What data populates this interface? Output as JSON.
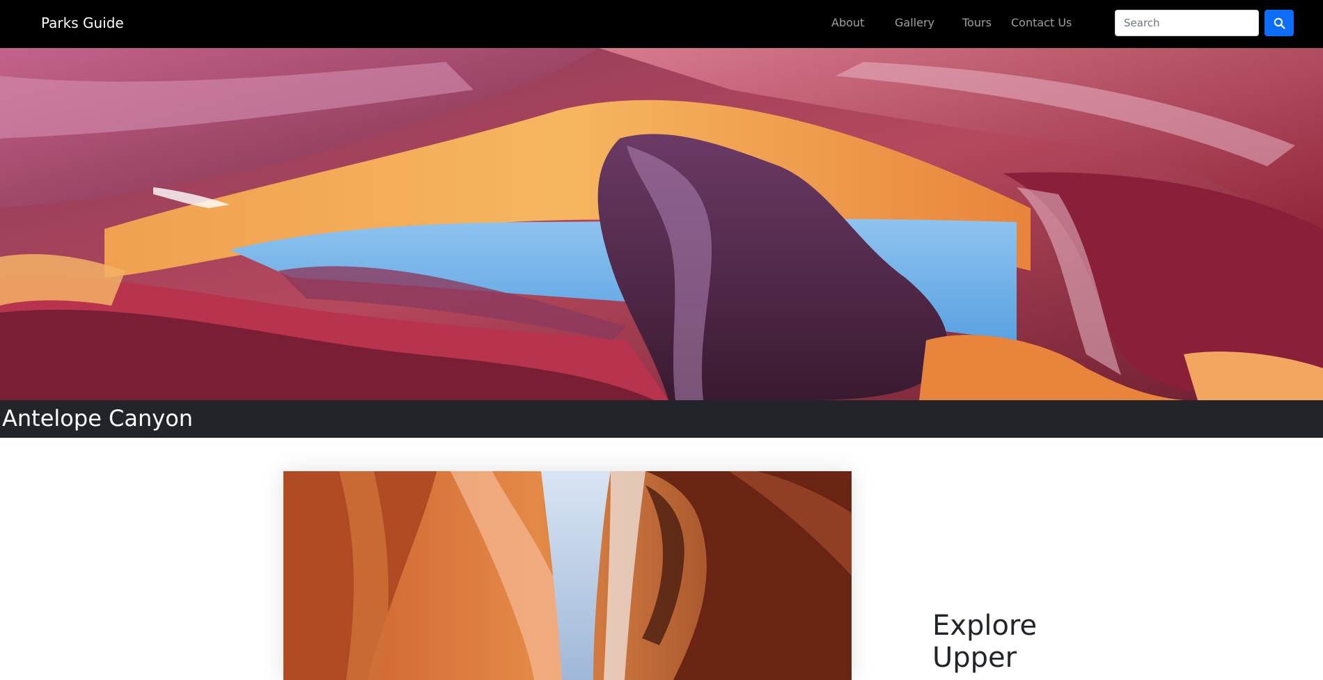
{
  "navbar": {
    "brand": "Parks Guide",
    "links": [
      {
        "label": "About"
      },
      {
        "label": "Gallery"
      },
      {
        "label": "Tours"
      },
      {
        "label": "Contact Us"
      }
    ],
    "search": {
      "placeholder": "Search",
      "value": "",
      "button_icon": "search-icon",
      "button_color": "#0d6efd"
    },
    "background": "#000000"
  },
  "hero": {
    "image": "antelope-canyon-panorama"
  },
  "title_bar": {
    "title": "Antelope Canyon",
    "background": "#212529"
  },
  "feature": {
    "image": "upper-antelope-canyon-light-beam",
    "heading": "Explore Upper"
  }
}
